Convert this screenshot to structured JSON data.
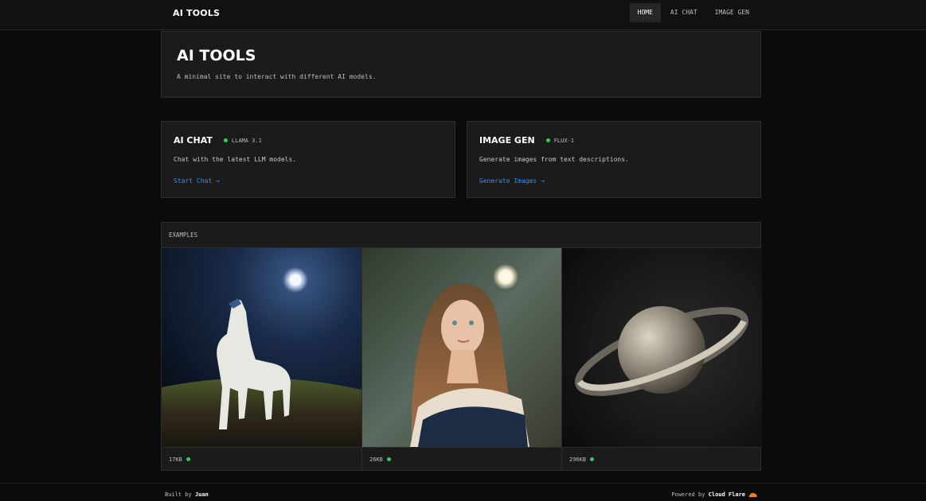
{
  "header": {
    "brand": "AI TOOLS",
    "nav": [
      {
        "label": "HOME",
        "active": true
      },
      {
        "label": "AI CHAT",
        "active": false
      },
      {
        "label": "IMAGE GEN",
        "active": false
      }
    ]
  },
  "hero": {
    "title": "AI TOOLS",
    "subtitle": "A minimal site to interact with different AI models."
  },
  "cards": [
    {
      "title": "AI CHAT",
      "model": "LLAMA 3.1",
      "description": "Chat with the latest LLM models.",
      "link": "Start Chat →"
    },
    {
      "title": "IMAGE GEN",
      "model": "FLUX-1",
      "description": "Generate images from text descriptions.",
      "link": "Generate Images →"
    }
  ],
  "examples": {
    "label": "EXAMPLES",
    "items": [
      {
        "image": "white-horse-moonlit-image",
        "size": "17KB"
      },
      {
        "image": "woman-portrait-image",
        "size": "26KB"
      },
      {
        "image": "saturn-planet-image",
        "size": "296KB"
      }
    ]
  },
  "footer": {
    "built_by_prefix": "Built by",
    "built_by_name": "Juan",
    "powered_by_prefix": "Powered by",
    "powered_by_name": "Cloud Flare",
    "powered_icon": "cloud-icon"
  },
  "colors": {
    "background": "#0b0b0b",
    "panel": "#1b1b1b",
    "accent_link": "#2e8fff",
    "status_green": "#2fcc5a",
    "cloudflare_orange": "#f38020"
  }
}
